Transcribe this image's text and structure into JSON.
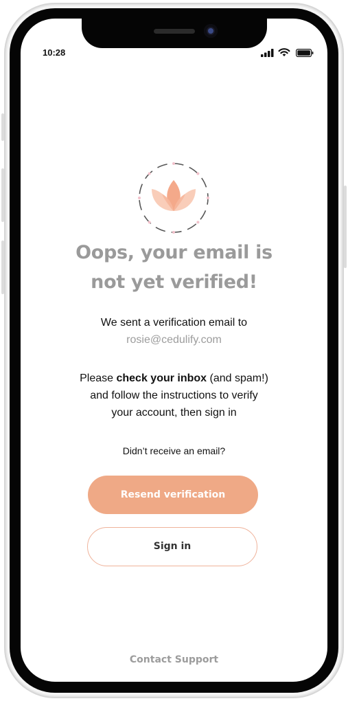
{
  "status_bar": {
    "time": "10:28"
  },
  "brand": {
    "logo_icon": "lotus-icon",
    "accent_color": "#efa986"
  },
  "heading": {
    "line1": "Oops, your email is",
    "line2": "not yet verified!"
  },
  "sent_message": {
    "text": "We sent a verification email to",
    "email": "rosie@cedulify.com"
  },
  "instructions": {
    "before_bold": "Please ",
    "bold": "check your inbox",
    "after_bold": " (and spam!)",
    "line2": "and follow the instructions to verify",
    "line3": "your account, then sign in"
  },
  "resend_prompt": "Didn’t receive an email?",
  "buttons": {
    "resend_label": "Resend verification",
    "sign_in_label": "Sign in"
  },
  "footer": {
    "support_label": "Contact Support"
  }
}
